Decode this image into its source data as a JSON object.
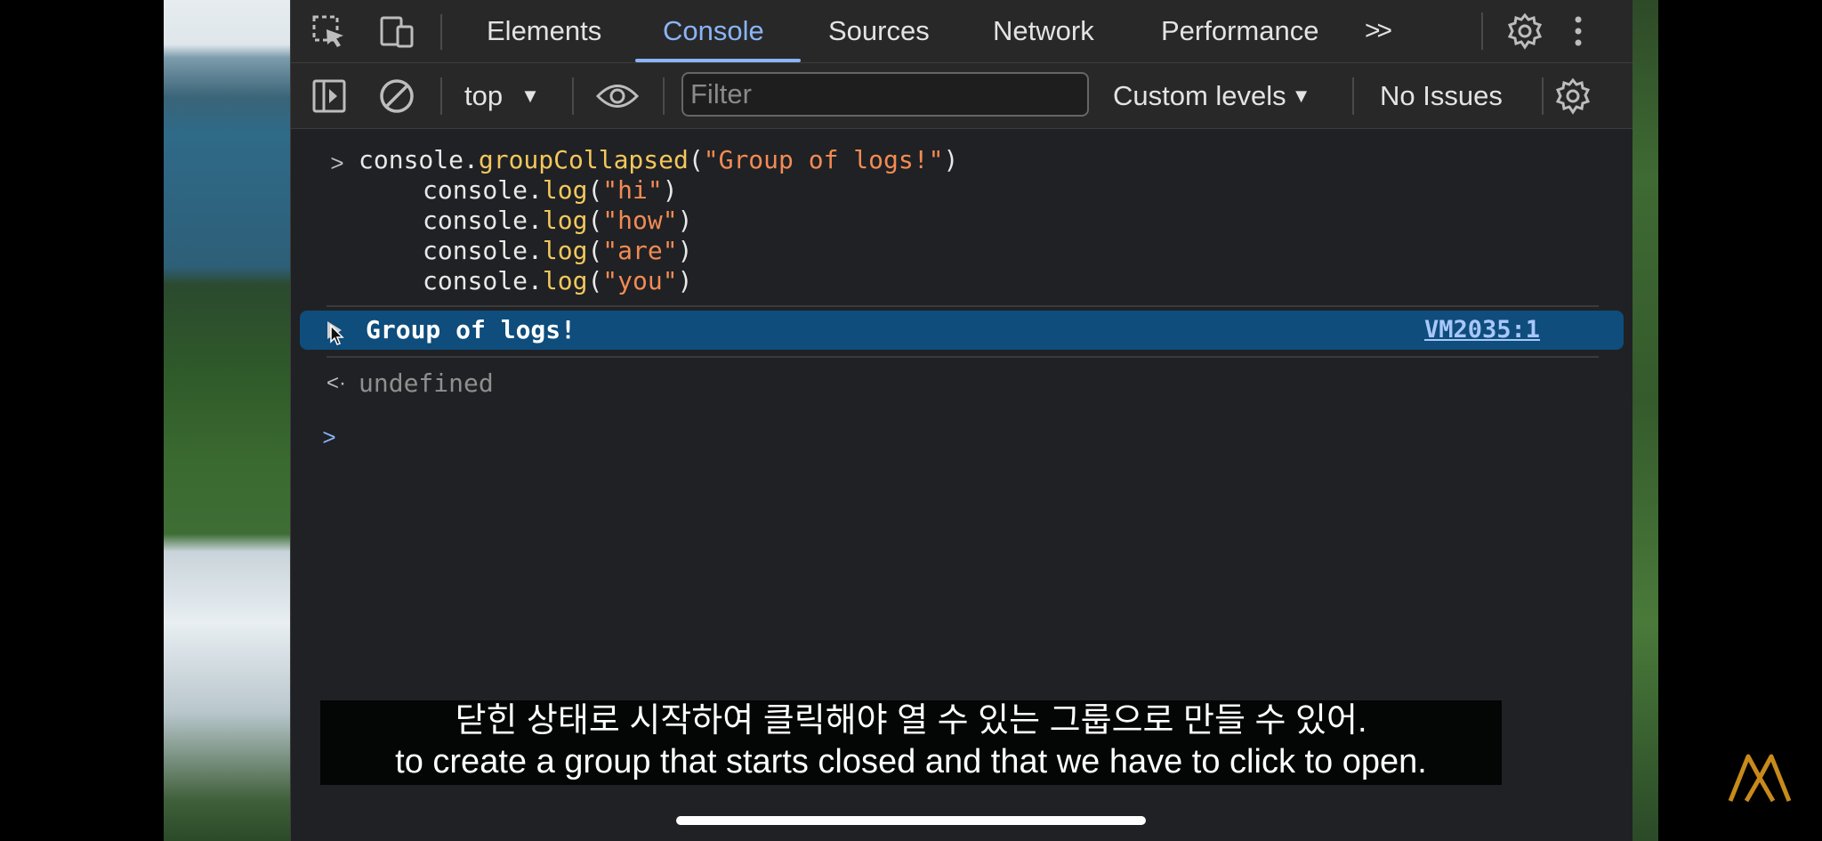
{
  "tabs": [
    "Elements",
    "Console",
    "Sources",
    "Network",
    "Performance"
  ],
  "tabs_overflow_glyph": ">>",
  "toolbar": {
    "context": "top",
    "filter_placeholder": "Filter",
    "levels": "Custom levels",
    "issues": "No Issues"
  },
  "console": {
    "input_prompt": ">",
    "line1_obj": "console.",
    "line1_fn": "groupCollapsed",
    "line1_arg": "\"Group of logs!\"",
    "logs": [
      {
        "obj": "console.",
        "fn": "log",
        "arg": "\"hi\""
      },
      {
        "obj": "console.",
        "fn": "log",
        "arg": "\"how\""
      },
      {
        "obj": "console.",
        "fn": "log",
        "arg": "\"are\""
      },
      {
        "obj": "console.",
        "fn": "log",
        "arg": "\"you\""
      }
    ],
    "group_label": "Group of logs!",
    "group_source": "VM2035:1",
    "result_prompt": "<·",
    "result": "undefined",
    "empty_prompt": ">"
  },
  "subtitles": {
    "korean": "닫힌 상태로 시작하여 클릭해야 열 수 있는 그룹으로 만들 수 있어.",
    "english": "to create a group that starts closed and that we have to click to open."
  },
  "colors": {
    "accent": "#8ab4f8",
    "selected_row": "#0e4d7c",
    "function": "#f2c75c",
    "string": "#f28b54",
    "logo": "#c88a1a"
  }
}
